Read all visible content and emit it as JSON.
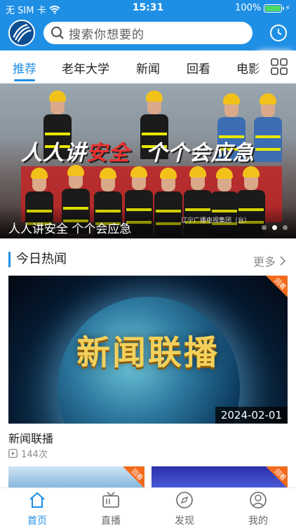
{
  "status_bar": {
    "carrier": "无 SIM 卡",
    "time": "15:31",
    "battery": "100%"
  },
  "search": {
    "placeholder": "搜索你想要的"
  },
  "tabs": [
    {
      "label": "推荐",
      "active": true
    },
    {
      "label": "老年大学",
      "active": false
    },
    {
      "label": "新闻",
      "active": false
    },
    {
      "label": "回看",
      "active": false
    },
    {
      "label": "电影",
      "active": false
    }
  ],
  "banner": {
    "slogan_part1": "人人讲",
    "slogan_red": "安全",
    "slogan_part2": "个个会应急",
    "caption": "人人讲安全 个个会应急",
    "credit": "辽宁广播电视集团（台）",
    "slide_count": 3,
    "active_slide": 1
  },
  "section": {
    "title": "今日热闻",
    "more_label": "更多"
  },
  "featured": {
    "thumb_text": "新闻联播",
    "badge": "回看",
    "date": "2024-02-01",
    "title": "新闻联播",
    "views": "144次"
  },
  "more_items": [
    {
      "badge": "回看"
    },
    {
      "badge": "回看"
    }
  ],
  "bottom_nav": [
    {
      "label": "首页",
      "icon": "home-icon",
      "active": true
    },
    {
      "label": "直播",
      "icon": "tv-icon",
      "active": false
    },
    {
      "label": "发现",
      "icon": "compass-icon",
      "active": false
    },
    {
      "label": "我的",
      "icon": "user-icon",
      "active": false
    }
  ],
  "colors": {
    "accent": "#1f8fe6",
    "badge": "#f26b1d"
  }
}
